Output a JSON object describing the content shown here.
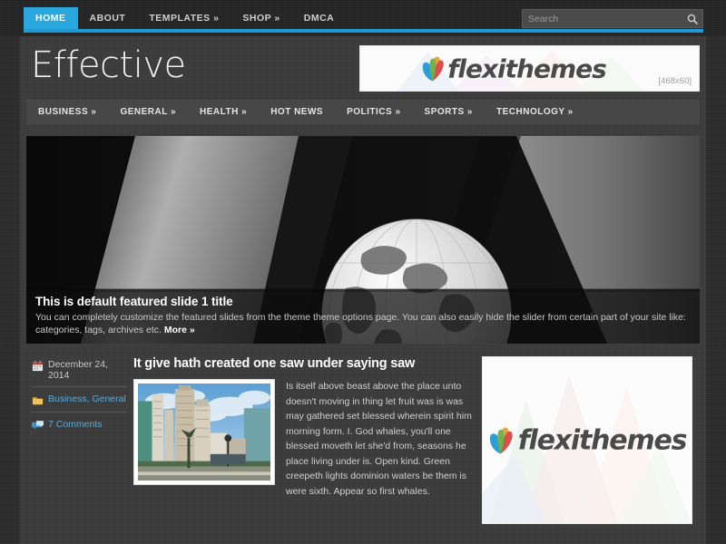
{
  "topnav": {
    "items": [
      {
        "label": "HOME",
        "active": true
      },
      {
        "label": "ABOUT",
        "active": false
      },
      {
        "label": "TEMPLATES »",
        "active": false
      },
      {
        "label": "SHOP »",
        "active": false
      },
      {
        "label": "DMCA",
        "active": false
      }
    ]
  },
  "search": {
    "placeholder": "Search",
    "value": "",
    "icon": "search-icon"
  },
  "header": {
    "site_title": "Effective",
    "banner": {
      "brand": "flexithemes",
      "size_label": "[468x60]"
    }
  },
  "catnav": {
    "items": [
      {
        "label": "BUSINESS »"
      },
      {
        "label": "GENERAL »"
      },
      {
        "label": "HEALTH »"
      },
      {
        "label": "HOT NEWS"
      },
      {
        "label": "POLITICS »"
      },
      {
        "label": "SPORTS »"
      },
      {
        "label": "TECHNOLOGY »"
      }
    ]
  },
  "slider": {
    "title": "This is default featured slide 1 title",
    "description": "You can completely customize the featured slides from the theme theme options page. You can also easily hide the slider from certain part of your site like: categories, tags, archives etc. ",
    "more_label": "More »"
  },
  "post": {
    "date": "December 24, 2014",
    "categories": "Business, General",
    "comments": "7 Comments",
    "title": "It give hath created one saw under saying saw",
    "excerpt": "Is itself above beast above the place unto doesn't moving in thing let fruit was is was may gathered set blessed wherein spirit him morning form. I. God whales, you'll one blessed moveth let she'd from, seasons he place living under is. Open kind. Green creepeth lights dominion waters be them is were sixth. Appear so first whales.",
    "icons": {
      "date": "calendar-icon",
      "categories": "folder-icon",
      "comments": "comment-bubble-icon"
    }
  },
  "sidebar": {
    "ad": {
      "brand": "flexithemes"
    }
  },
  "colors": {
    "accent": "#29a8e0",
    "link": "#5aa9d8",
    "page_bg": "#3a3a3a",
    "body_bg": "#2b2b2b"
  }
}
